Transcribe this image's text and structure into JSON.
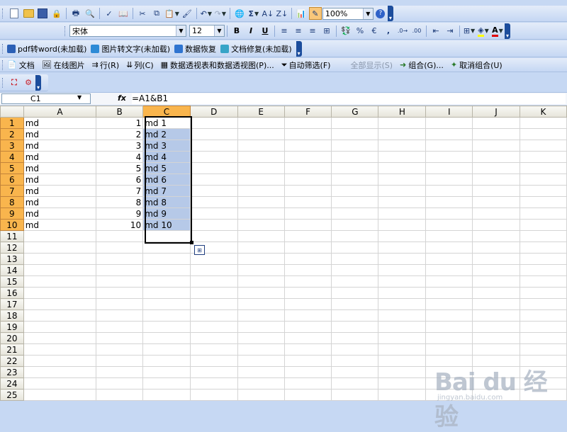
{
  "toolbar_std": {
    "zoom": "100%"
  },
  "toolbar_fmt": {
    "font": "宋体",
    "size": "12",
    "bold": "B",
    "italic": "I",
    "underline": "U",
    "percent": "%",
    "comma": ","
  },
  "plugins": [
    {
      "label": "pdf转word(未加载)",
      "color": "#2b5fb5"
    },
    {
      "label": "图片转文字(未加载)",
      "color": "#2e8bd6"
    },
    {
      "label": "数据恢复",
      "color": "#2f74d0"
    },
    {
      "label": "文档修复(未加载)",
      "color": "#37a4c7"
    }
  ],
  "menu2": {
    "doc": "文档",
    "online_pic": "在线图片",
    "row": "行(R)",
    "col": "列(C)",
    "pivot": "数据透视表和数据透视图(P)...",
    "autofilter": "自动筛选(F)",
    "show_all": "全部显示(S)",
    "group": "组合(G)...",
    "ungroup": "取消组合(U)"
  },
  "formula_bar": {
    "name_box": "C1",
    "fx": "fx",
    "formula": "=A1&B1"
  },
  "sheet": {
    "columns": [
      "A",
      "B",
      "C",
      "D",
      "E",
      "F",
      "G",
      "H",
      "I",
      "J",
      "K"
    ],
    "selected_column": "C",
    "rows": [
      {
        "n": "1",
        "a": "md",
        "b": "1",
        "c": "md 1"
      },
      {
        "n": "2",
        "a": "md",
        "b": "2",
        "c": "md 2"
      },
      {
        "n": "3",
        "a": "md",
        "b": "3",
        "c": "md 3"
      },
      {
        "n": "4",
        "a": "md",
        "b": "4",
        "c": "md 4"
      },
      {
        "n": "5",
        "a": "md",
        "b": "5",
        "c": "md 5"
      },
      {
        "n": "6",
        "a": "md",
        "b": "6",
        "c": "md 6"
      },
      {
        "n": "7",
        "a": "md",
        "b": "7",
        "c": "md 7"
      },
      {
        "n": "8",
        "a": "md",
        "b": "8",
        "c": "md 8"
      },
      {
        "n": "9",
        "a": "md",
        "b": "9",
        "c": "md 9"
      },
      {
        "n": "10",
        "a": "md",
        "b": "10",
        "c": "md 10"
      },
      {
        "n": "11",
        "a": "",
        "b": "",
        "c": ""
      },
      {
        "n": "12",
        "a": "",
        "b": "",
        "c": ""
      },
      {
        "n": "13",
        "a": "",
        "b": "",
        "c": ""
      },
      {
        "n": "14",
        "a": "",
        "b": "",
        "c": ""
      },
      {
        "n": "15",
        "a": "",
        "b": "",
        "c": ""
      },
      {
        "n": "16",
        "a": "",
        "b": "",
        "c": ""
      },
      {
        "n": "17",
        "a": "",
        "b": "",
        "c": ""
      },
      {
        "n": "18",
        "a": "",
        "b": "",
        "c": ""
      },
      {
        "n": "19",
        "a": "",
        "b": "",
        "c": ""
      },
      {
        "n": "20",
        "a": "",
        "b": "",
        "c": ""
      },
      {
        "n": "21",
        "a": "",
        "b": "",
        "c": ""
      },
      {
        "n": "22",
        "a": "",
        "b": "",
        "c": ""
      },
      {
        "n": "23",
        "a": "",
        "b": "",
        "c": ""
      },
      {
        "n": "24",
        "a": "",
        "b": "",
        "c": ""
      },
      {
        "n": "25",
        "a": "",
        "b": "",
        "c": ""
      }
    ]
  },
  "watermark": {
    "brand": "Bai du 经验",
    "url": "jingyan.baidu.com"
  }
}
